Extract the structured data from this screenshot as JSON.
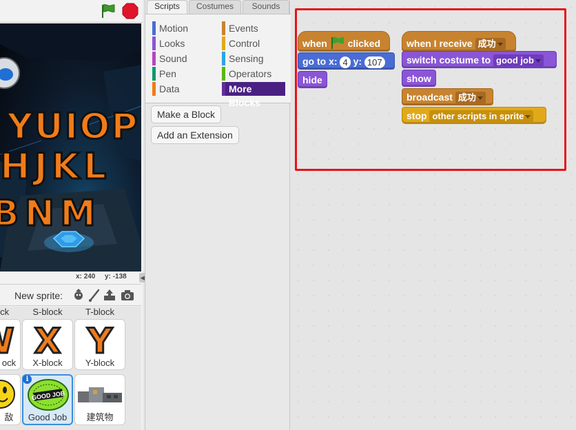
{
  "stage": {
    "mouse_x_label": "x:",
    "mouse_x": "240",
    "mouse_y_label": "y:",
    "mouse_y": "-138",
    "keyboard_rows": [
      "YUIOP",
      "HJKL",
      "BNM"
    ]
  },
  "sprite_pane": {
    "new_sprite_label": "New sprite:",
    "top_labels": [
      "ock",
      "S-block",
      "T-block"
    ],
    "sprites": [
      {
        "glyph": "W",
        "caption": "ock"
      },
      {
        "glyph": "X",
        "caption": "X-block"
      },
      {
        "glyph": "Y",
        "caption": "Y-block"
      },
      {
        "glyph": "",
        "caption": "敌"
      },
      {
        "glyph": "",
        "caption": "Good Job",
        "selected": true,
        "badge_text": "GOOD JOB"
      },
      {
        "glyph": "",
        "caption": "建筑物"
      }
    ]
  },
  "palette": {
    "tabs": [
      "Scripts",
      "Costumes",
      "Sounds"
    ],
    "categories_left": [
      {
        "label": "Motion",
        "color": "#4a6cd4"
      },
      {
        "label": "Looks",
        "color": "#8a55d7"
      },
      {
        "label": "Sound",
        "color": "#bb42c3"
      },
      {
        "label": "Pen",
        "color": "#0e9a6c"
      },
      {
        "label": "Data",
        "color": "#ee7d16"
      }
    ],
    "categories_right": [
      {
        "label": "Events",
        "color": "#c88330"
      },
      {
        "label": "Control",
        "color": "#e1a91a"
      },
      {
        "label": "Sensing",
        "color": "#2ca5e2"
      },
      {
        "label": "Operators",
        "color": "#5cb712"
      },
      {
        "label": "More Blocks",
        "color": "#632d99",
        "active": true
      }
    ],
    "make_block_label": "Make a Block",
    "add_extension_label": "Add an Extension"
  },
  "scripts": {
    "script1": {
      "hat_when": "when",
      "hat_clicked": "clicked",
      "goto_label": "go to x:",
      "goto_x": "4",
      "goto_y_label": "y:",
      "goto_y": "107",
      "hide_label": "hide"
    },
    "script2": {
      "hat_label": "when I receive",
      "hat_message": "成功",
      "switch_label": "switch costume to",
      "switch_value": "good job",
      "show_label": "show",
      "broadcast_label": "broadcast",
      "broadcast_message": "成功",
      "stop_label": "stop",
      "stop_value": "other scripts in sprite"
    }
  },
  "colors": {
    "highlight": "#e4141b",
    "events": "#c88330",
    "motion": "#4a6cd4",
    "looks": "#8a55d7",
    "control": "#e1a91a"
  }
}
